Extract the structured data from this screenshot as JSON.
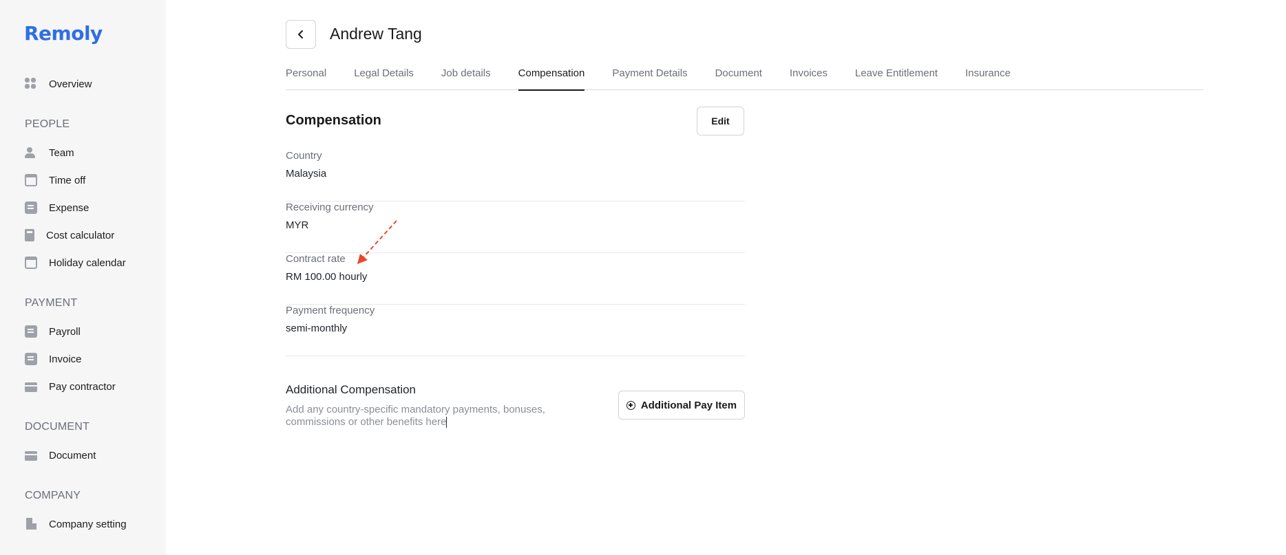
{
  "brand": {
    "name": "Remoly",
    "color": "#2f6fe4"
  },
  "sidebar": {
    "overview": {
      "label": "Overview",
      "icon": "grid-icon"
    },
    "sections": [
      {
        "title": "PEOPLE",
        "items": [
          {
            "label": "Team",
            "icon": "team-icon"
          },
          {
            "label": "Time off",
            "icon": "calendar-check-icon"
          },
          {
            "label": "Expense",
            "icon": "clipboard-icon"
          },
          {
            "label": "Cost calculator",
            "icon": "calculator-icon"
          },
          {
            "label": "Holiday calendar",
            "icon": "calendar-icon"
          }
        ]
      },
      {
        "title": "PAYMENT",
        "items": [
          {
            "label": "Payroll",
            "icon": "payroll-icon"
          },
          {
            "label": "Invoice",
            "icon": "invoice-icon"
          },
          {
            "label": "Pay contractor",
            "icon": "card-icon"
          }
        ]
      },
      {
        "title": "DOCUMENT",
        "items": [
          {
            "label": "Document",
            "icon": "document-icon"
          }
        ]
      },
      {
        "title": "COMPANY",
        "items": [
          {
            "label": "Company setting",
            "icon": "building-icon"
          }
        ]
      }
    ]
  },
  "header": {
    "person_name": "Andrew Tang"
  },
  "tabs": [
    {
      "label": "Personal"
    },
    {
      "label": "Legal Details"
    },
    {
      "label": "Job details"
    },
    {
      "label": "Compensation",
      "active": true
    },
    {
      "label": "Payment Details"
    },
    {
      "label": "Document"
    },
    {
      "label": "Invoices"
    },
    {
      "label": "Leave Entitlement"
    },
    {
      "label": "Insurance"
    }
  ],
  "compensation": {
    "title": "Compensation",
    "edit_label": "Edit",
    "fields": [
      {
        "label": "Country",
        "value": "Malaysia"
      },
      {
        "label": "Receiving currency",
        "value": "MYR"
      },
      {
        "label": "Contract rate",
        "value": "RM 100.00 hourly"
      },
      {
        "label": "Payment frequency",
        "value": "semi-monthly"
      }
    ]
  },
  "additional": {
    "title": "Additional Compensation",
    "description": "Add any country-specific mandatory payments, bonuses, commissions or other benefits here",
    "button_label": "Additional Pay Item"
  },
  "annotation": {
    "arrow_color": "#e8472a"
  }
}
